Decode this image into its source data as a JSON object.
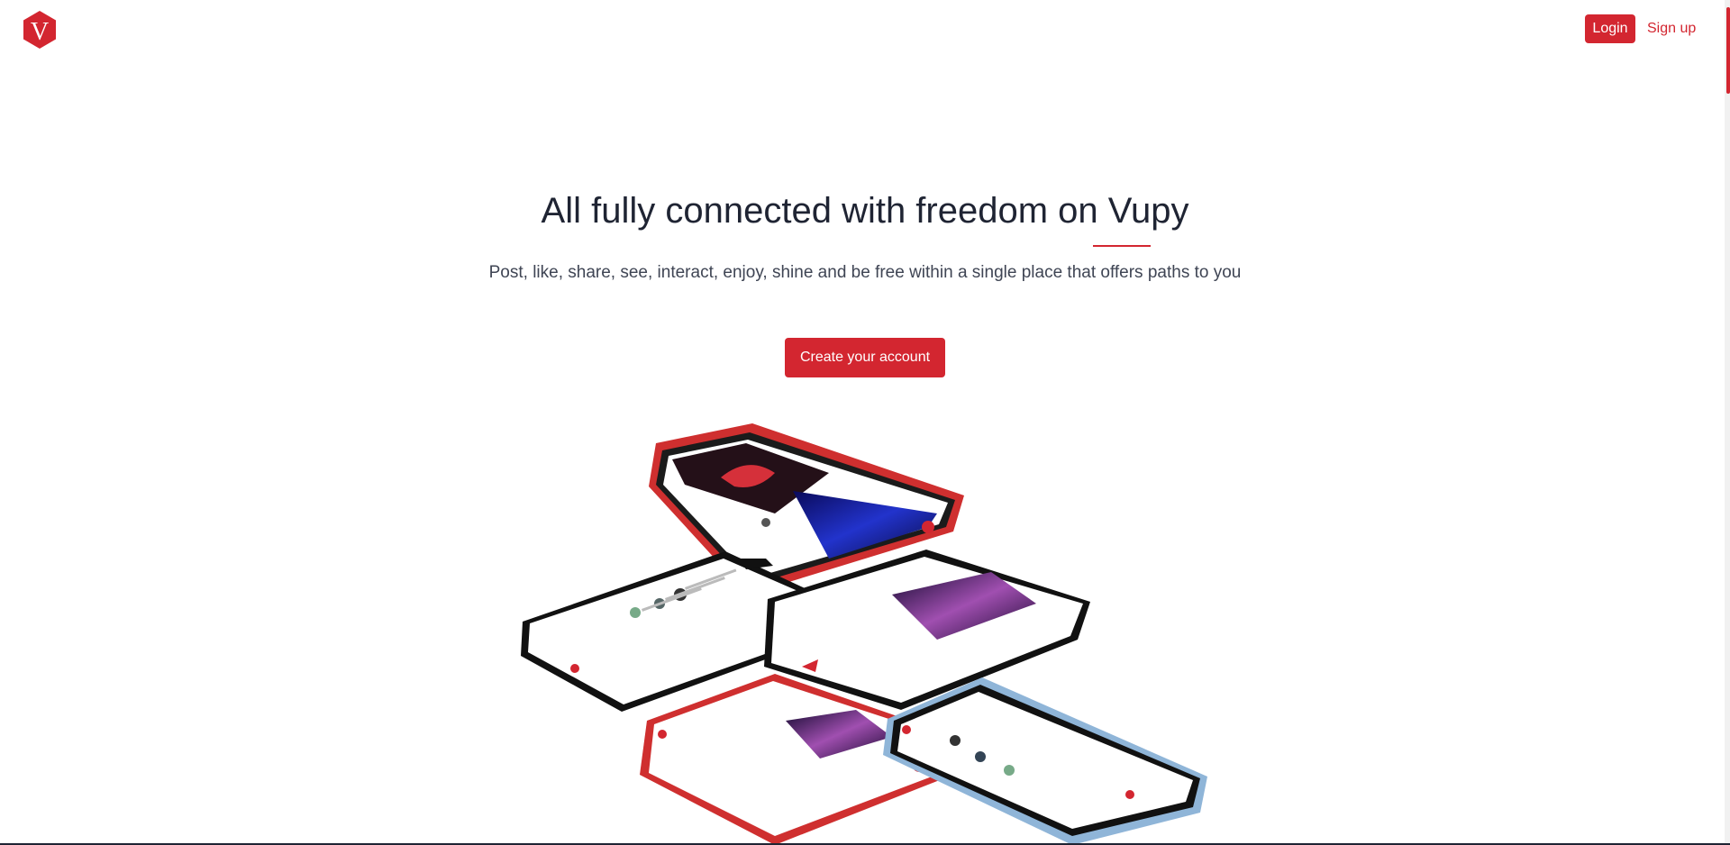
{
  "header": {
    "logo_letter": "V",
    "login_label": "Login",
    "signup_label": "Sign up"
  },
  "hero": {
    "title": "All fully connected with freedom on Vupy",
    "subtitle": "Post, like, share, see, interact, enjoy, shine and be free within a single place that offers paths to you",
    "cta_label": "Create your account"
  },
  "colors": {
    "brand": "#d32630",
    "text": "#1f2433",
    "subtext": "#3f4554",
    "background": "#ffffff"
  },
  "icons": [
    "vupy-logo-icon"
  ]
}
